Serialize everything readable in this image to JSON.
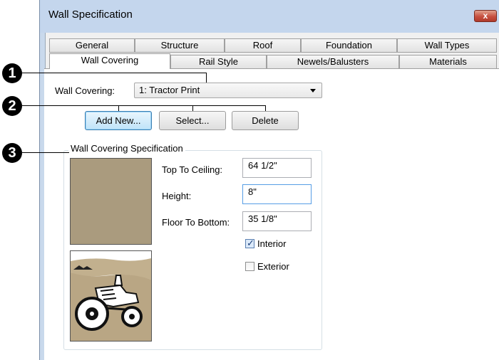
{
  "window": {
    "title": "Wall Specification",
    "close_glyph": "x"
  },
  "tabs_top": [
    "General",
    "Structure",
    "Roof",
    "Foundation",
    "Wall Types"
  ],
  "tabs_bottom": [
    "Wall Covering",
    "Rail Style",
    "Newels/Balusters",
    "Materials"
  ],
  "active_tab": "Wall Covering",
  "wall_covering": {
    "label": "Wall Covering:",
    "selected": "1: Tractor Print"
  },
  "buttons": {
    "add_new": "Add New...",
    "select": "Select...",
    "delete": "Delete"
  },
  "spec": {
    "group_title": "Wall Covering Specification",
    "top_to_ceiling_label": "Top To Ceiling:",
    "top_to_ceiling_value": "64 1/2\"",
    "height_label": "Height:",
    "height_value": "8\"",
    "floor_to_bottom_label": "Floor To Bottom:",
    "floor_to_bottom_value": "35 1/8\"",
    "interior_label": "Interior",
    "interior_checked": true,
    "exterior_label": "Exterior",
    "exterior_checked": false,
    "swatch_color": "#aa9b7e"
  },
  "callouts": [
    "1",
    "2",
    "3"
  ]
}
